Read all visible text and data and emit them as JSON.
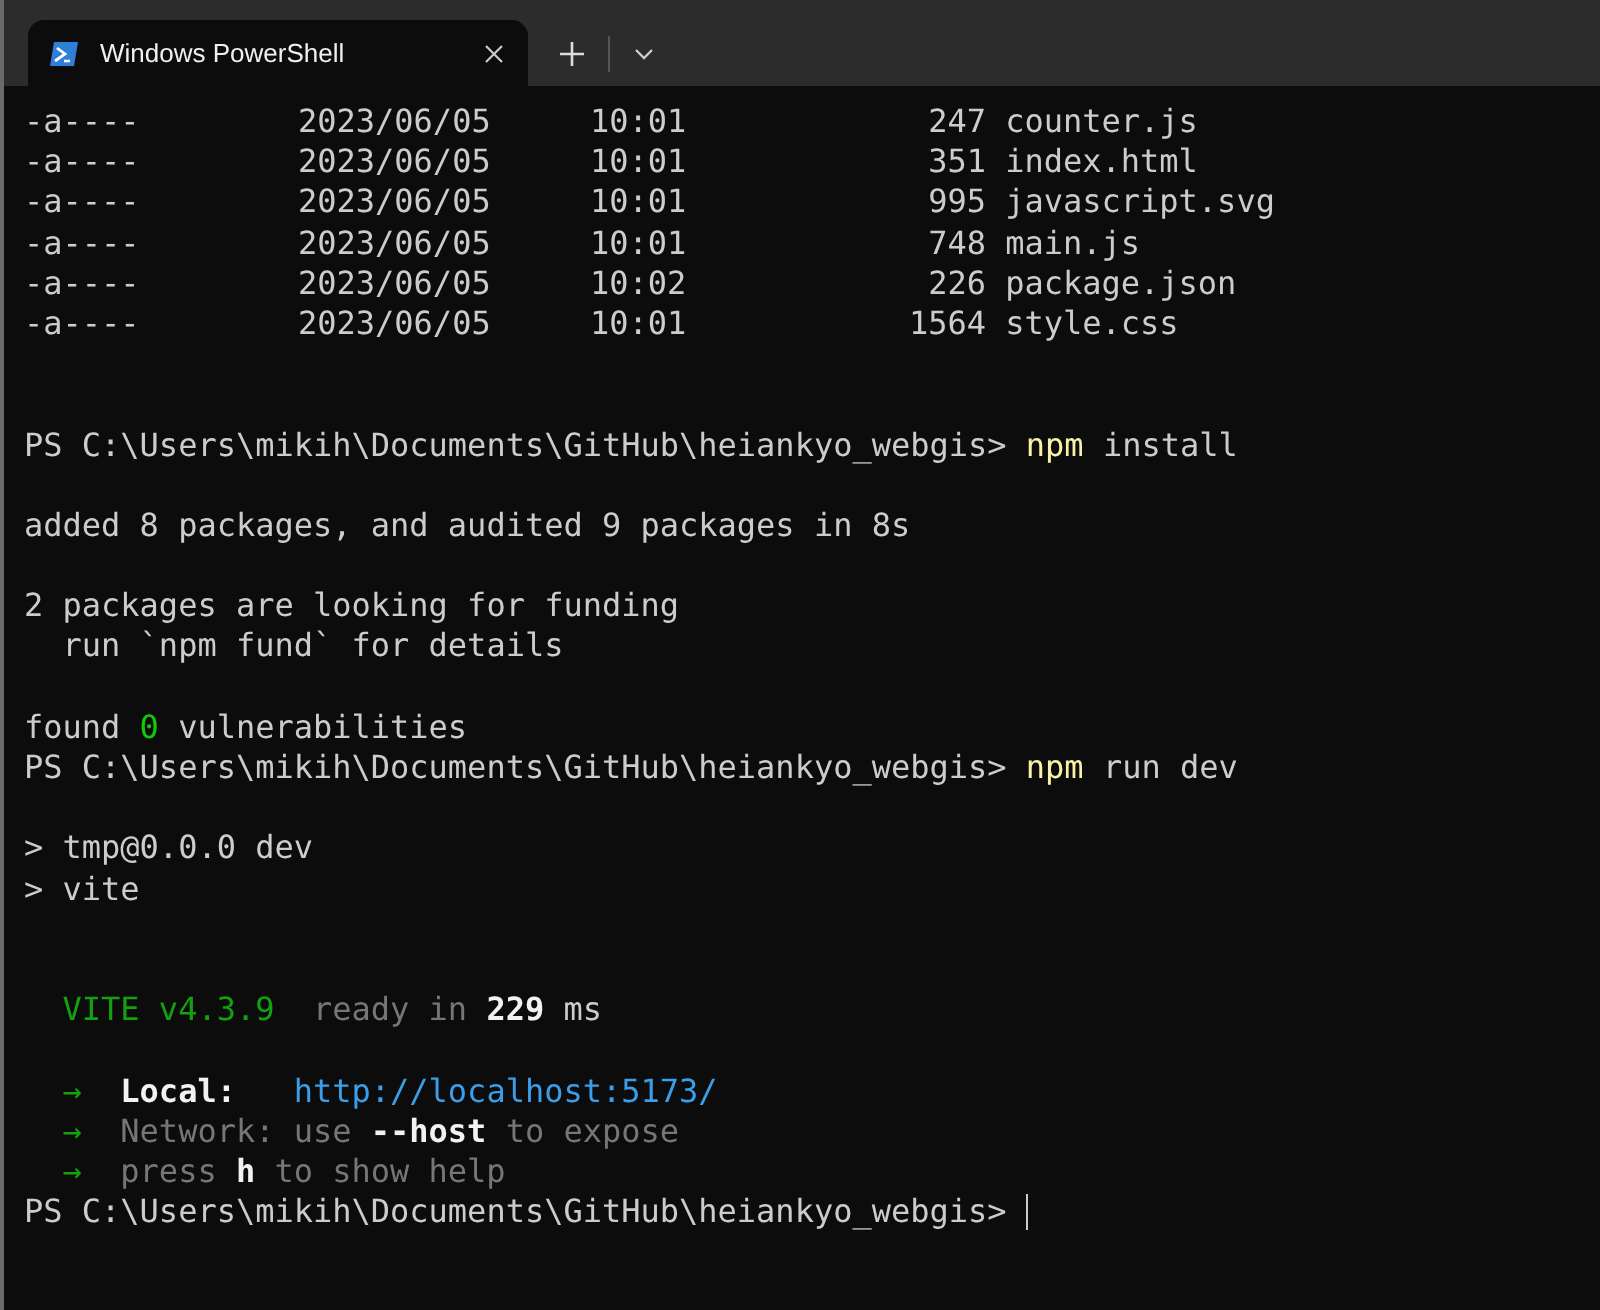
{
  "tabs": [
    {
      "title": "Windows PowerShell",
      "selected": true
    }
  ],
  "lines": [
    {
      "kind": "file",
      "mode": "-a----",
      "date": "2023/06/05",
      "time": "10:01",
      "length": "247",
      "name": "counter.js"
    },
    {
      "kind": "file",
      "mode": "-a----",
      "date": "2023/06/05",
      "time": "10:01",
      "length": "351",
      "name": "index.html"
    },
    {
      "kind": "file",
      "mode": "-a----",
      "date": "2023/06/05",
      "time": "10:01",
      "length": "995",
      "name": "javascript.svg"
    },
    {
      "kind": "file",
      "mode": "-a----",
      "date": "2023/06/05",
      "time": "10:01",
      "length": "748",
      "name": "main.js"
    },
    {
      "kind": "file",
      "mode": "-a----",
      "date": "2023/06/05",
      "time": "10:02",
      "length": "226",
      "name": "package.json"
    },
    {
      "kind": "file",
      "mode": "-a----",
      "date": "2023/06/05",
      "time": "10:01",
      "length": "1564",
      "name": "style.css"
    },
    {
      "kind": "blank"
    },
    {
      "kind": "blank"
    },
    {
      "kind": "text",
      "segments": [
        {
          "kind": "plain",
          "text": "PS C:\\Users\\mikih\\Documents\\GitHub\\heiankyo_webgis>"
        },
        {
          "kind": "command",
          "text": "npm"
        },
        {
          "kind": "plain",
          "text": "install"
        }
      ]
    },
    {
      "kind": "blank"
    },
    {
      "kind": "text",
      "segments": [
        {
          "kind": "plain",
          "text": "added 8 packages, and audited 9 packages in 8s"
        }
      ]
    },
    {
      "kind": "blank"
    },
    {
      "kind": "text",
      "segments": [
        {
          "kind": "plain",
          "text": "2 packages are looking for funding"
        }
      ]
    },
    {
      "kind": "text",
      "segments": [
        {
          "kind": "plain",
          "text": "  run `npm fund` for details"
        }
      ]
    },
    {
      "kind": "blank"
    },
    {
      "kind": "text",
      "segments": [
        {
          "kind": "plain",
          "text": "found"
        },
        {
          "kind": "success",
          "text": "0"
        },
        {
          "kind": "plain",
          "text": "vulnerabilities"
        }
      ]
    },
    {
      "kind": "text",
      "segments": [
        {
          "kind": "plain",
          "text": "PS C:\\Users\\mikih\\Documents\\GitHub\\heiankyo_webgis>"
        },
        {
          "kind": "command",
          "text": "npm"
        },
        {
          "kind": "plain",
          "text": "run dev"
        }
      ]
    },
    {
      "kind": "blank"
    },
    {
      "kind": "text",
      "segments": [
        {
          "kind": "plain",
          "text": "> tmp@0.0.0 dev"
        }
      ]
    },
    {
      "kind": "text",
      "segments": [
        {
          "kind": "plain",
          "text": "> vite"
        }
      ]
    },
    {
      "kind": "blank"
    },
    {
      "kind": "blank"
    },
    {
      "kind": "text",
      "segments": [
        {
          "kind": "brand",
          "text": "  VITE v4.3.9"
        },
        {
          "kind": "muted",
          "text": " ready in"
        },
        {
          "kind": "emphasis",
          "text": "229"
        },
        {
          "kind": "plain",
          "text": "ms"
        }
      ]
    },
    {
      "kind": "blank"
    },
    {
      "kind": "text",
      "segments": [
        {
          "kind": "arrow",
          "text": "  →"
        },
        {
          "kind": "emphasis",
          "text": " Local:"
        },
        {
          "kind": "link",
          "text": "  http://localhost:5173/"
        }
      ]
    },
    {
      "kind": "text",
      "segments": [
        {
          "kind": "arrow",
          "text": "  →"
        },
        {
          "kind": "muted",
          "text": " Network: use"
        },
        {
          "kind": "emphasis",
          "text": "--host"
        },
        {
          "kind": "muted",
          "text": "to expose"
        }
      ]
    },
    {
      "kind": "text",
      "segments": [
        {
          "kind": "arrow",
          "text": "  →"
        },
        {
          "kind": "muted",
          "text": " press"
        },
        {
          "kind": "emphasis",
          "text": "h"
        },
        {
          "kind": "muted",
          "text": "to show help"
        }
      ]
    },
    {
      "kind": "text",
      "cursor": true,
      "segments": [
        {
          "kind": "plain",
          "text": "PS C:\\Users\\mikih\\Documents\\GitHub\\heiankyo_webgis>"
        }
      ]
    }
  ]
}
